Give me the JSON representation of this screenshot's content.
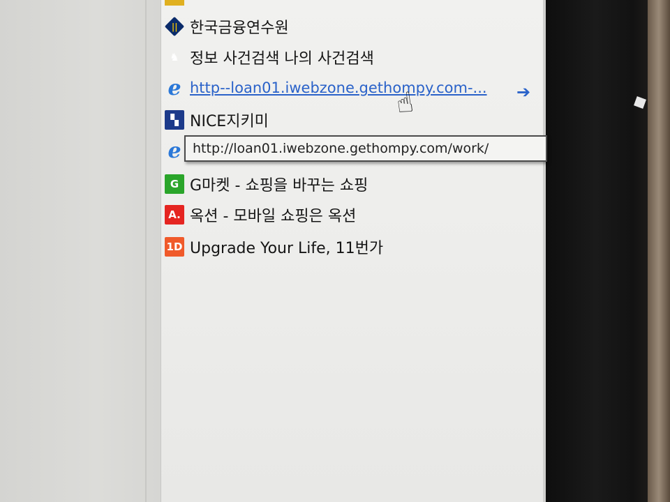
{
  "favorites": {
    "items": [
      {
        "label": "한국금융연수원",
        "icon": "kfi-logo-icon"
      },
      {
        "label": "정보  사건검색  나의 사건검색",
        "icon": "court-icon"
      },
      {
        "label": "http--loan01.iwebzone.gethompy.com-...",
        "icon": "ie-icon",
        "hovered": true
      },
      {
        "label": "NICE지키미",
        "icon": "nice-icon"
      },
      {
        "label": "",
        "icon": "ie-icon"
      },
      {
        "label": "G마켓 - 쇼핑을 바꾸는 쇼핑",
        "icon": "gmarket-icon"
      },
      {
        "label": "옥션 - 모바일 쇼핑은 옥션",
        "icon": "auction-icon"
      },
      {
        "label": "Upgrade Your Life, 11번가",
        "icon": "11st-icon"
      }
    ]
  },
  "tooltip": {
    "text": "http://loan01.iwebzone.gethompy.com/work/"
  },
  "icons": {
    "ie_glyph": "e",
    "kfi_glyph": "||",
    "nice_glyph": "▚",
    "gmarket_glyph": "G",
    "auction_glyph": "A.",
    "st_glyph": "1D",
    "arrow_glyph": "➔",
    "cursor_glyph": "☝"
  },
  "colors": {
    "link": "#2a62c9",
    "text": "#151515",
    "panel_bg": "#eeeeec",
    "gmarket": "#2aa52a",
    "auction": "#e52521",
    "st": "#f05a2a"
  }
}
